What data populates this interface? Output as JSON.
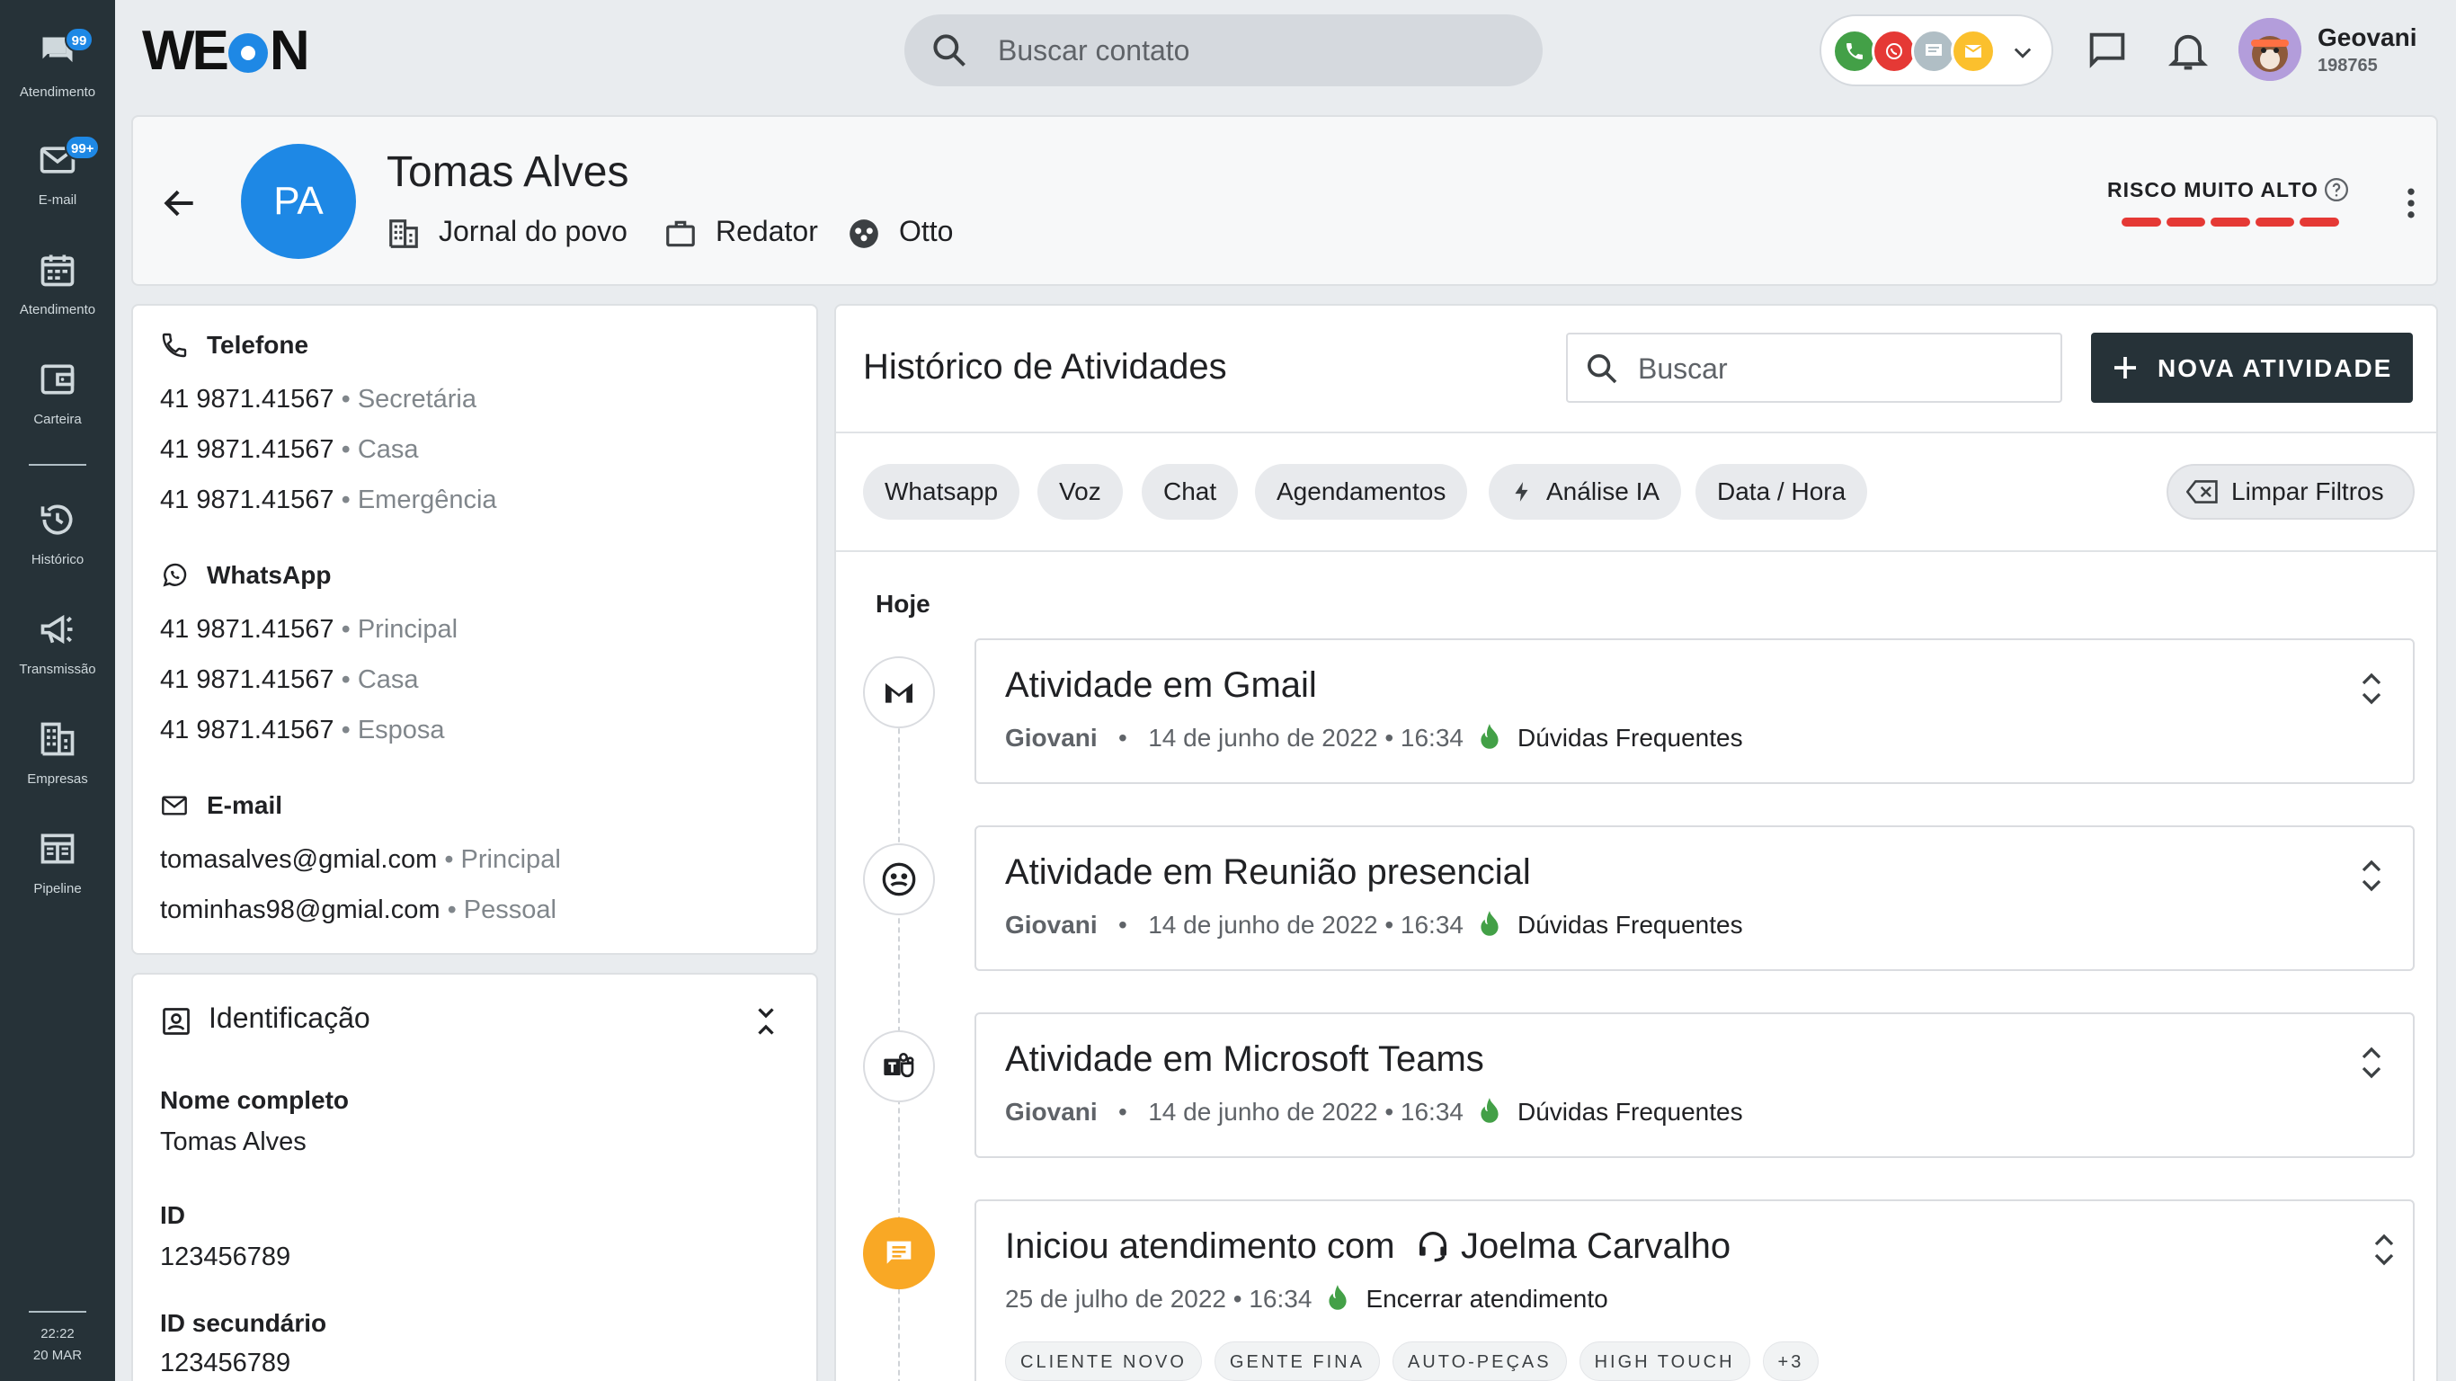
{
  "sidebar": {
    "items": [
      {
        "label": "Atendimento",
        "badge": "99",
        "icon": "chat-icon"
      },
      {
        "label": "E-mail",
        "badge": "99+",
        "icon": "mail-icon"
      },
      {
        "label": "Atendimento",
        "icon": "calendar-icon"
      },
      {
        "label": "Carteira",
        "icon": "wallet-icon"
      },
      {
        "label": "Histórico",
        "icon": "history-icon"
      },
      {
        "label": "Transmissão",
        "icon": "megaphone-icon"
      },
      {
        "label": "Empresas",
        "icon": "building-icon"
      },
      {
        "label": "Pipeline",
        "icon": "pipeline-icon"
      }
    ],
    "clock": {
      "time": "22:22",
      "date": "20 MAR"
    }
  },
  "topbar": {
    "logo": {
      "left": "WE",
      "right": "N"
    },
    "search_placeholder": "Buscar contato",
    "user": {
      "name": "Geovani",
      "id": "198765"
    }
  },
  "contact": {
    "initials": "PA",
    "name": "Tomas Alves",
    "company": "Jornal do povo",
    "role": "Redator",
    "team": "Otto",
    "risk_label": "RISCO MUITO ALTO",
    "risk_level": 5
  },
  "info": {
    "phone": {
      "title": "Telefone",
      "rows": [
        {
          "value": "41 9871.41567",
          "sep": " • ",
          "type": "Secretária"
        },
        {
          "value": "41 9871.41567",
          "sep": " • ",
          "type": "Casa"
        },
        {
          "value": "41 9871.41567",
          "sep": " • ",
          "type": "Emergência"
        }
      ]
    },
    "whatsapp": {
      "title": "WhatsApp",
      "rows": [
        {
          "value": "41 9871.41567",
          "sep": " • ",
          "type": "Principal"
        },
        {
          "value": "41 9871.41567",
          "sep": " • ",
          "type": "Casa"
        },
        {
          "value": "41 9871.41567",
          "sep": " • ",
          "type": "Esposa"
        }
      ]
    },
    "email": {
      "title": "E-mail",
      "rows": [
        {
          "value": "tomasalves@gmial.com",
          "sep": " • ",
          "type": "Principal"
        },
        {
          "value": "tominhas98@gmial.com",
          "sep": " • ",
          "type": "Pessoal"
        }
      ]
    }
  },
  "identification": {
    "title": "Identificação",
    "fields": [
      {
        "label": "Nome completo",
        "value": "Tomas Alves"
      },
      {
        "label": "ID",
        "value": "123456789"
      },
      {
        "label": "ID secundário",
        "value": "123456789"
      }
    ]
  },
  "activity": {
    "title": "Histórico de Atividades",
    "search_placeholder": "Buscar",
    "new_button": "NOVA ATIVIDADE",
    "filters": [
      "Whatsapp",
      "Voz",
      "Chat",
      "Agendamentos",
      "Análise IA",
      "Data / Hora"
    ],
    "clear_filters": "Limpar Filtros",
    "day_label": "Hoje",
    "items": [
      {
        "title": "Atividade em Gmail",
        "author": "Giovani",
        "dot": "•",
        "date": "14 de junho de 2022 • 16:34",
        "tag": "Dúvidas Frequentes",
        "icon": "gmail-icon"
      },
      {
        "title": "Atividade em Reunião presencial",
        "author": "Giovani",
        "dot": "•",
        "date": "14 de junho de 2022 • 16:34",
        "tag": "Dúvidas Frequentes",
        "icon": "meeting-icon"
      },
      {
        "title": "Atividade em Microsoft Teams",
        "author": "Giovani",
        "dot": "•",
        "date": "14 de junho de 2022 • 16:34",
        "tag": "Dúvidas Frequentes",
        "icon": "teams-icon"
      },
      {
        "title_prefix": "Iniciou atendimento com",
        "agent": "Joelma Carvalho",
        "date": "25 de julho de 2022 • 16:34",
        "tag": "Encerrar atendimento",
        "badges": [
          "CLIENTE NOVO",
          "GENTE FINA",
          "AUTO-PEÇAS",
          "HIGH TOUCH",
          "+3"
        ],
        "icon": "message-icon"
      }
    ]
  },
  "colors": {
    "accent": "#1e88e5",
    "sidebar": "#263238",
    "risk": "#e53935",
    "fire": "#43a047",
    "amber": "#f9a825"
  }
}
